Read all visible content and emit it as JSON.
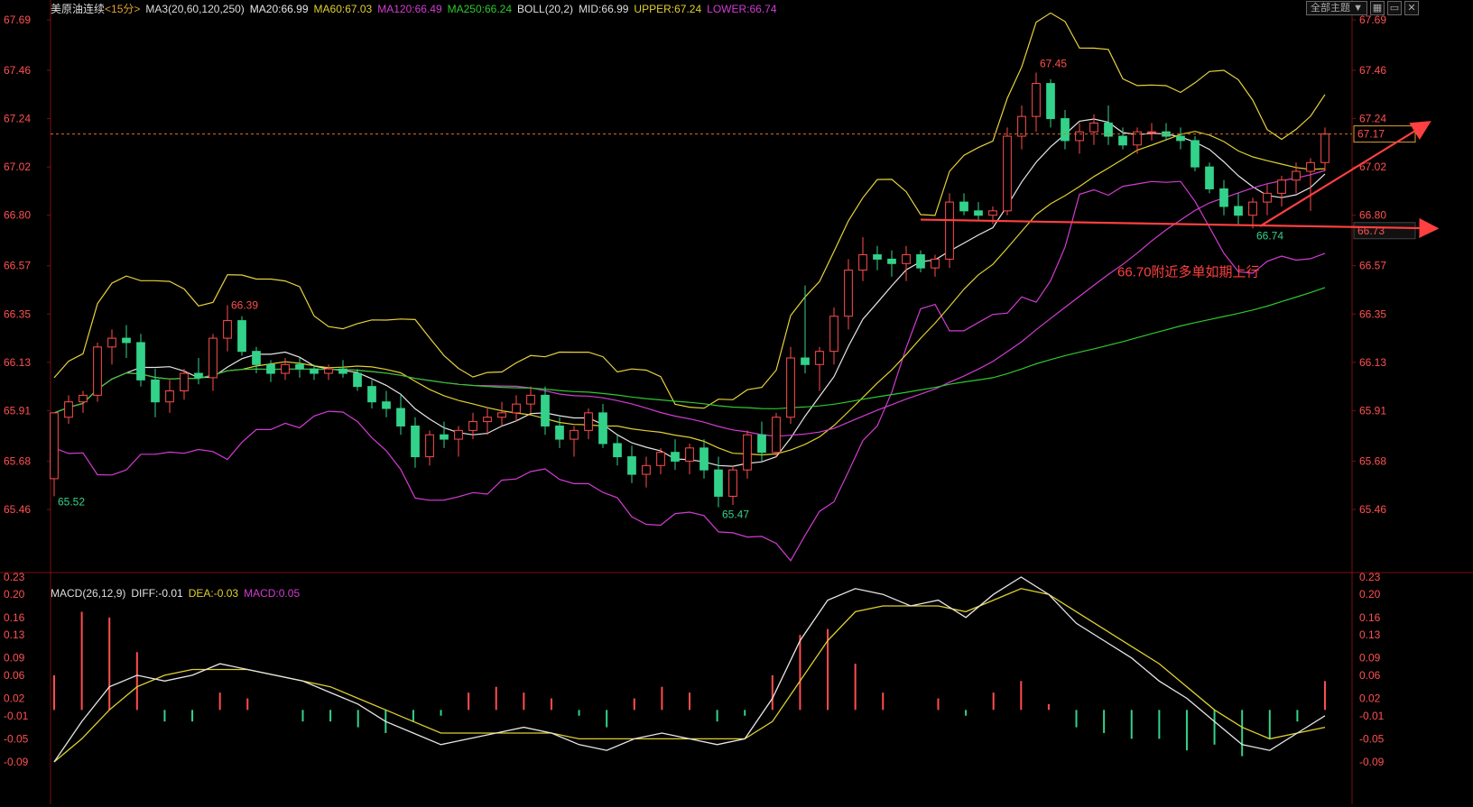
{
  "header": {
    "symbol": "美原油连续",
    "period": "<15分>",
    "ma_label": "MA3(20,60,120,250)",
    "ma20": "MA20:66.99",
    "ma60": "MA60:67.03",
    "ma120": "MA120:66.49",
    "ma250": "MA250:66.24",
    "boll": "BOLL(20,2)",
    "mid": "MID:66.99",
    "upper": "UPPER:67.24",
    "lower": "LOWER:66.74"
  },
  "toolbar": {
    "theme_label": "全部主题",
    "theme_arrow": "▼"
  },
  "macd_header": {
    "label": "MACD(26,12,9)",
    "diff": "DIFF:-0.01",
    "dea": "DEA:-0.03",
    "macd": "MACD:0.05"
  },
  "price_axis": [
    "67.69",
    "67.46",
    "67.24",
    "67.02",
    "66.80",
    "66.57",
    "66.35",
    "66.13",
    "65.91",
    "65.68",
    "65.46"
  ],
  "macd_axis": [
    "0.23",
    "0.20",
    "0.16",
    "0.13",
    "0.09",
    "0.06",
    "0.02",
    "-0.01",
    "-0.05",
    "-0.09"
  ],
  "current_price_tag": "67.17",
  "cursor_price_tag": "66.73",
  "annotations": {
    "high_label": "67.45",
    "high_left_label": "66.39",
    "low_left_label": "65.52",
    "low_mid_label": "65.47",
    "recent_low_label": "66.74",
    "comment": "66.70附近多单如期上行"
  },
  "colors": {
    "up": "#ff4d4d",
    "down": "#33d28a",
    "ma20": "#e6e6e6",
    "ma60": "#e0d030",
    "ma120": "#d23cd2",
    "ma250": "#2ec82e",
    "boll_upper": "#e6d23c",
    "boll_lower": "#d23cd2",
    "diff": "#e6e6e6",
    "dea": "#e0d030",
    "axis_text": "#ff5050",
    "annotation": "#ff4040"
  },
  "chart_data": {
    "type": "candlestick",
    "interval": "15分",
    "ylim": [
      65.46,
      67.69
    ],
    "macd_ylim": [
      -0.09,
      0.23
    ],
    "ohlc": [
      [
        65.6,
        65.9,
        65.52,
        65.9
      ],
      [
        65.88,
        65.98,
        65.85,
        65.95
      ],
      [
        65.95,
        66.0,
        65.9,
        65.98
      ],
      [
        65.98,
        66.22,
        65.95,
        66.2
      ],
      [
        66.2,
        66.28,
        66.12,
        66.24
      ],
      [
        66.24,
        66.3,
        66.15,
        66.22
      ],
      [
        66.22,
        66.26,
        66.02,
        66.05
      ],
      [
        66.05,
        66.1,
        65.88,
        65.95
      ],
      [
        65.95,
        66.05,
        65.9,
        66.0
      ],
      [
        66.0,
        66.1,
        65.96,
        66.08
      ],
      [
        66.08,
        66.15,
        66.03,
        66.06
      ],
      [
        66.06,
        66.26,
        66.0,
        66.24
      ],
      [
        66.24,
        66.39,
        66.18,
        66.32
      ],
      [
        66.32,
        66.34,
        66.16,
        66.18
      ],
      [
        66.18,
        66.2,
        66.08,
        66.12
      ],
      [
        66.12,
        66.14,
        66.04,
        66.08
      ],
      [
        66.08,
        66.15,
        66.05,
        66.12
      ],
      [
        66.12,
        66.15,
        66.06,
        66.1
      ],
      [
        66.1,
        66.12,
        66.05,
        66.08
      ],
      [
        66.08,
        66.12,
        66.05,
        66.1
      ],
      [
        66.1,
        66.14,
        66.06,
        66.08
      ],
      [
        66.08,
        66.1,
        66.0,
        66.02
      ],
      [
        66.02,
        66.05,
        65.92,
        65.95
      ],
      [
        65.95,
        66.0,
        65.88,
        65.92
      ],
      [
        65.92,
        65.98,
        65.8,
        65.84
      ],
      [
        65.84,
        65.88,
        65.65,
        65.7
      ],
      [
        65.7,
        65.82,
        65.66,
        65.8
      ],
      [
        65.8,
        65.86,
        65.74,
        65.78
      ],
      [
        65.78,
        65.84,
        65.7,
        65.82
      ],
      [
        65.82,
        65.9,
        65.78,
        65.86
      ],
      [
        65.86,
        65.92,
        65.8,
        65.88
      ],
      [
        65.88,
        65.95,
        65.84,
        65.9
      ],
      [
        65.9,
        65.98,
        65.86,
        65.94
      ],
      [
        65.94,
        66.02,
        65.9,
        65.98
      ],
      [
        65.98,
        66.02,
        65.8,
        65.84
      ],
      [
        65.84,
        65.88,
        65.74,
        65.78
      ],
      [
        65.78,
        65.84,
        65.7,
        65.82
      ],
      [
        65.82,
        65.92,
        65.78,
        65.9
      ],
      [
        65.9,
        65.94,
        65.74,
        65.76
      ],
      [
        65.76,
        65.8,
        65.66,
        65.7
      ],
      [
        65.7,
        65.75,
        65.58,
        65.62
      ],
      [
        65.62,
        65.7,
        65.56,
        65.66
      ],
      [
        65.66,
        65.74,
        65.62,
        65.72
      ],
      [
        65.72,
        65.78,
        65.64,
        65.68
      ],
      [
        65.68,
        65.76,
        65.62,
        65.74
      ],
      [
        65.74,
        65.78,
        65.6,
        65.64
      ],
      [
        65.64,
        65.7,
        65.47,
        65.52
      ],
      [
        65.52,
        65.66,
        65.48,
        65.64
      ],
      [
        65.64,
        65.82,
        65.6,
        65.8
      ],
      [
        65.8,
        65.86,
        65.68,
        65.72
      ],
      [
        65.72,
        65.9,
        65.7,
        65.88
      ],
      [
        65.88,
        66.2,
        65.85,
        66.15
      ],
      [
        66.15,
        66.48,
        66.08,
        66.12
      ],
      [
        66.12,
        66.2,
        66.0,
        66.18
      ],
      [
        66.18,
        66.38,
        66.12,
        66.34
      ],
      [
        66.34,
        66.6,
        66.28,
        66.55
      ],
      [
        66.55,
        66.7,
        66.5,
        66.62
      ],
      [
        66.62,
        66.66,
        66.55,
        66.6
      ],
      [
        66.6,
        66.64,
        66.52,
        66.58
      ],
      [
        66.58,
        66.66,
        66.5,
        66.62
      ],
      [
        66.62,
        66.64,
        66.54,
        66.56
      ],
      [
        66.56,
        66.62,
        66.52,
        66.6
      ],
      [
        66.6,
        66.9,
        66.56,
        66.86
      ],
      [
        66.86,
        66.9,
        66.8,
        66.82
      ],
      [
        66.82,
        66.86,
        66.78,
        66.8
      ],
      [
        66.8,
        66.84,
        66.76,
        66.82
      ],
      [
        66.82,
        67.2,
        66.8,
        67.16
      ],
      [
        67.16,
        67.3,
        67.1,
        67.25
      ],
      [
        67.25,
        67.45,
        67.18,
        67.4
      ],
      [
        67.4,
        67.42,
        67.2,
        67.24
      ],
      [
        67.24,
        67.28,
        67.1,
        67.14
      ],
      [
        67.14,
        67.22,
        67.08,
        67.18
      ],
      [
        67.18,
        67.26,
        67.12,
        67.22
      ],
      [
        67.22,
        67.3,
        67.12,
        67.16
      ],
      [
        67.16,
        67.2,
        67.1,
        67.12
      ],
      [
        67.12,
        67.2,
        67.08,
        67.18
      ],
      [
        67.18,
        67.22,
        67.14,
        67.18
      ],
      [
        67.18,
        67.22,
        67.14,
        67.16
      ],
      [
        67.16,
        67.2,
        67.1,
        67.14
      ],
      [
        67.14,
        67.16,
        67.0,
        67.02
      ],
      [
        67.02,
        67.04,
        66.9,
        66.92
      ],
      [
        66.92,
        66.96,
        66.8,
        66.84
      ],
      [
        66.84,
        66.9,
        66.76,
        66.8
      ],
      [
        66.8,
        66.88,
        66.74,
        66.86
      ],
      [
        66.86,
        66.94,
        66.8,
        66.9
      ],
      [
        66.9,
        66.98,
        66.84,
        66.96
      ],
      [
        66.96,
        67.04,
        66.9,
        67.0
      ],
      [
        67.0,
        67.06,
        66.82,
        67.04
      ],
      [
        67.04,
        67.2,
        67.0,
        67.17
      ]
    ],
    "macd": {
      "diff": [
        -0.09,
        -0.02,
        0.04,
        0.06,
        0.05,
        0.06,
        0.08,
        0.07,
        0.06,
        0.05,
        0.03,
        0.01,
        -0.02,
        -0.04,
        -0.06,
        -0.05,
        -0.04,
        -0.03,
        -0.04,
        -0.06,
        -0.07,
        -0.05,
        -0.04,
        -0.05,
        -0.06,
        -0.05,
        0.02,
        0.12,
        0.19,
        0.21,
        0.2,
        0.18,
        0.19,
        0.16,
        0.2,
        0.23,
        0.2,
        0.15,
        0.12,
        0.09,
        0.05,
        0.02,
        -0.02,
        -0.06,
        -0.07,
        -0.04,
        -0.01
      ],
      "dea": [
        -0.09,
        -0.05,
        0.0,
        0.04,
        0.06,
        0.07,
        0.07,
        0.07,
        0.06,
        0.05,
        0.04,
        0.02,
        0.0,
        -0.02,
        -0.04,
        -0.04,
        -0.04,
        -0.04,
        -0.04,
        -0.05,
        -0.05,
        -0.05,
        -0.05,
        -0.05,
        -0.05,
        -0.05,
        -0.02,
        0.05,
        0.12,
        0.17,
        0.18,
        0.18,
        0.18,
        0.17,
        0.19,
        0.21,
        0.2,
        0.17,
        0.14,
        0.11,
        0.08,
        0.04,
        0.0,
        -0.03,
        -0.05,
        -0.04,
        -0.03
      ],
      "hist": [
        0.06,
        0.17,
        0.16,
        0.1,
        -0.02,
        -0.02,
        0.03,
        0.02,
        0.0,
        -0.02,
        -0.02,
        -0.03,
        -0.04,
        -0.02,
        -0.01,
        0.03,
        0.04,
        0.03,
        0.02,
        -0.01,
        -0.03,
        0.02,
        0.04,
        0.03,
        -0.02,
        -0.01,
        0.06,
        0.13,
        0.14,
        0.08,
        0.03,
        0.0,
        0.02,
        -0.01,
        0.03,
        0.05,
        0.01,
        -0.03,
        -0.04,
        -0.05,
        -0.05,
        -0.07,
        -0.06,
        -0.08,
        -0.05,
        -0.02,
        0.05
      ]
    }
  }
}
